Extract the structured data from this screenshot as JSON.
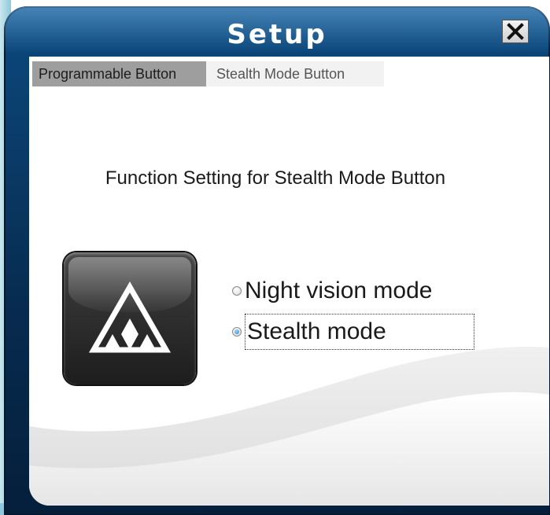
{
  "window": {
    "title": "Setup",
    "close_icon": "close-x-icon"
  },
  "tabs": [
    {
      "label": "Programmable Button",
      "active": true
    },
    {
      "label": "Stealth Mode Button",
      "active": false
    }
  ],
  "main": {
    "heading": "Function Setting for Stealth Mode Button",
    "button_icon": "triforce-triangle-icon",
    "options": [
      {
        "label": "Night vision mode",
        "selected": false
      },
      {
        "label": "Stealth mode",
        "selected": true
      }
    ]
  },
  "colors": {
    "frame": "#0a3a66",
    "tab_active": "#9e9e9e",
    "tab_inactive": "#f2f2f2",
    "radio_selected": "#2a7fc9"
  }
}
